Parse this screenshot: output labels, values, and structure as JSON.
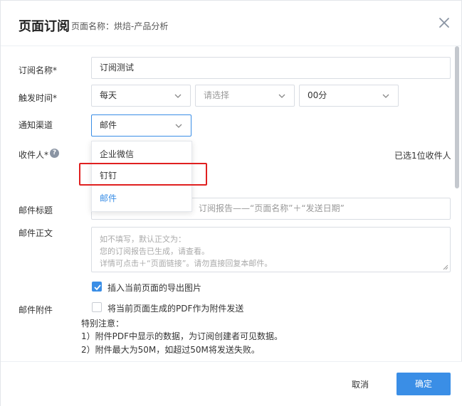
{
  "header": {
    "title": "页面订阅",
    "subtitle": "页面名称：烘焙-产品分析"
  },
  "form": {
    "subscription_name_label": "订阅名称*",
    "subscription_name_value": "订阅测试",
    "trigger_time_label": "触发时间*",
    "trigger_frequency": "每天",
    "trigger_day_placeholder": "请选择",
    "trigger_minute": "00分",
    "notify_channel_label": "通知渠道",
    "notify_channel_value": "邮件",
    "recipients_label": "收件人*",
    "recipients_count": "已选1位收件人",
    "email_subject_label": "邮件标题",
    "email_subject_placeholder": "订阅报告——“页面名称”＋“发送日期”",
    "email_body_label": "邮件正文",
    "email_body_placeholder_lines": [
      "如不填写，默认正文为：",
      "您的订阅报告已生成，请查看。",
      "详情可点击＋“页面链接”。请勿直接回复本邮件。"
    ],
    "insert_image_label": "插入当前页面的导出图片",
    "insert_image_checked": true,
    "attachment_label": "邮件附件",
    "pdf_attachment_label": "将当前页面生成的PDF作为附件发送",
    "pdf_attachment_checked": false,
    "notes": [
      "特别注意：",
      "1）附件PDF中显示的数据，为订阅创建者可见数据。",
      "2）附件最大为50M，如超过50M将发送失败。"
    ]
  },
  "dropdown": {
    "options": [
      "企业微信",
      "钉钉",
      "邮件"
    ],
    "selected": "邮件",
    "highlighted": "钉钉"
  },
  "footer": {
    "cancel_label": "取消",
    "ok_label": "确定"
  },
  "colors": {
    "accent": "#3a8ee6",
    "highlight_border": "#e02020"
  }
}
